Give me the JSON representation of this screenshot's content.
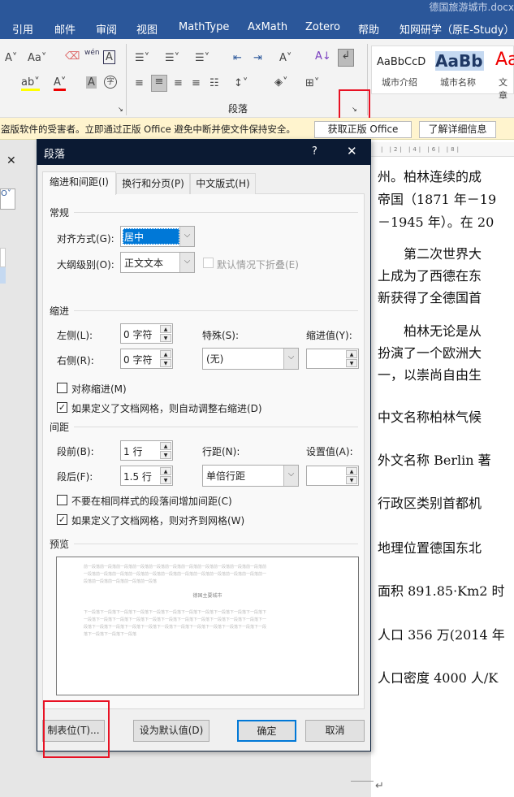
{
  "window": {
    "doc_title": "德国旅游城市.docx"
  },
  "menu": [
    "引用",
    "邮件",
    "审阅",
    "视图",
    "MathType",
    "AxMath",
    "Zotero",
    "帮助",
    "知网研学（原E-Study）"
  ],
  "ribbon": {
    "group_label": "段落",
    "styles": [
      {
        "preview": "AaBbCcD",
        "name": "城市介绍"
      },
      {
        "preview": "AaBb",
        "name": "城市名称"
      },
      {
        "preview": "Aa",
        "name": "文章"
      }
    ],
    "wen_label": "wén"
  },
  "warning": {
    "text": "盗版软件的受害者。立即通过正版 Office 避免中断并使文件保持安全。",
    "get_button": "获取正版 Office",
    "learn_button": "了解详细信息"
  },
  "dialog": {
    "title": "段落",
    "help": "?",
    "tabs": [
      "缩进和间距(I)",
      "换行和分页(P)",
      "中文版式(H)"
    ],
    "general": {
      "heading": "常规",
      "align_label": "对齐方式(G):",
      "align_value": "居中",
      "outline_label": "大纲级别(O):",
      "outline_value": "正文文本",
      "collapse_label": "默认情况下折叠(E)"
    },
    "indent": {
      "heading": "缩进",
      "left_label": "左侧(L):",
      "left_value": "0 字符",
      "right_label": "右侧(R):",
      "right_value": "0 字符",
      "special_label": "特殊(S):",
      "special_value": "(无)",
      "by_label": "缩进值(Y):",
      "mirror_label": "对称缩进(M)",
      "mirror_checked": false,
      "auto_label": "如果定义了文档网格，则自动调整右缩进(D)",
      "auto_checked": true
    },
    "spacing": {
      "heading": "间距",
      "before_label": "段前(B):",
      "before_value": "1 行",
      "after_label": "段后(F):",
      "after_value": "1.5 行",
      "line_label": "行距(N):",
      "line_value": "单倍行距",
      "at_label": "设置值(A):",
      "nospace_label": "不要在相同样式的段落间增加间距(C)",
      "nospace_checked": false,
      "grid_label": "如果定义了文档网格，则对齐到网格(W)",
      "grid_checked": true
    },
    "preview": {
      "heading": "预览",
      "before_lines": [
        "前一段落前一段落前一段落前一段落前一段落前一段落前一段落前一段落前一段落前一段落前一段落前",
        "一段落前一段落前一段落前一段落前一段落前一段落前一段落前一段落前一段落前一段落前一段落前一",
        "段落前一段落前一段落前一段落前一段落"
      ],
      "sample": "德国主要城市",
      "after_lines": [
        "下一段落下一段落下一段落下一段落下一段落下一段落下一段落下一段落下一段落下一段落下一段落下",
        "一段落下一段落下一段落下一段落下一段落下一段落下一段落下一段落下一段落下一段落下一段落下一",
        "段落下一段落下一段落下一段落下一段落下一段落下一段落下一段落下一段落下一段落下一段落下一段",
        "落下一段落下一段落下一段落"
      ]
    },
    "buttons": {
      "tabs": "制表位(T)...",
      "default": "设为默认值(D)",
      "ok": "确定",
      "cancel": "取消"
    }
  },
  "document": {
    "ruler": "| |2| |4| |6| |8|",
    "lines": [
      "州。柏林连续的成",
      "帝国（1871 年－19",
      "－1945 年）。在 20",
      "　　第二次世界大",
      "上成为了西德在东",
      "新获得了全德国首",
      "　　柏林无论是从",
      "扮演了一个欧洲大",
      "一，以崇尚自由生",
      "中文名称柏林气候",
      "外文名称 Berlin 著",
      "行政区类别首都机",
      "地理位置德国东北",
      "面积 891.85·Km2 时",
      "人口 356 万(2014 年",
      "人口密度 4000 人/K"
    ],
    "end_mark": "↵"
  },
  "colors": {
    "title_bar": "#2b579a",
    "dialog_title": "#0b1a33",
    "highlight": "#e81123",
    "selection": "#0078d7"
  }
}
